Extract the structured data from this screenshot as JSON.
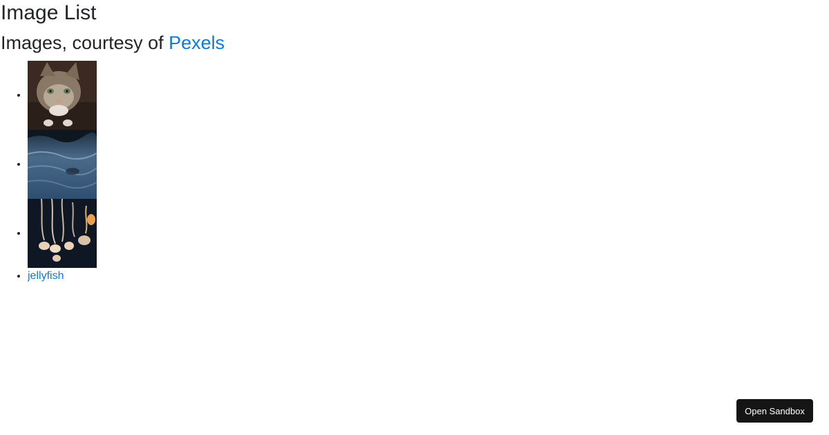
{
  "header": {
    "title": "Image List",
    "subtitle_prefix": "Images, courtesy of ",
    "subtitle_link": "Pexels"
  },
  "images": [
    {
      "alt": "cat",
      "icon": "cat-photo"
    },
    {
      "alt": "water",
      "icon": "water-photo"
    },
    {
      "alt": "jellyfish",
      "icon": "jellyfish-photo"
    },
    {
      "alt": "jellyfish",
      "broken": true
    }
  ],
  "sandbox": {
    "label": "Open Sandbox"
  },
  "colors": {
    "link": "#0d7ae0",
    "button_bg": "#151515",
    "text": "#212529"
  }
}
